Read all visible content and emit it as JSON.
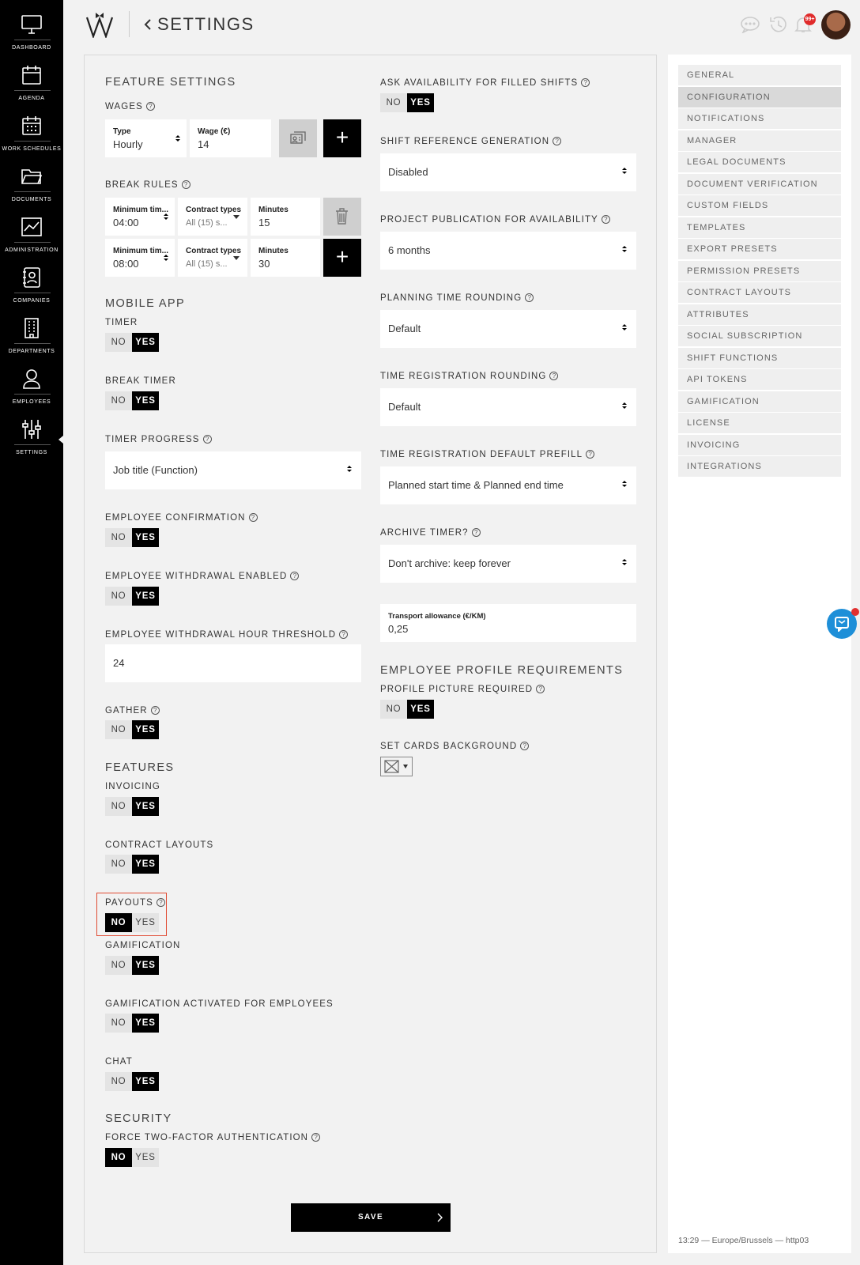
{
  "nav": {
    "items": [
      {
        "label": "DASHBOARD",
        "icon": "monitor-icon"
      },
      {
        "label": "AGENDA",
        "icon": "calendar-icon"
      },
      {
        "label": "WORK SCHEDULES",
        "icon": "calendar-grid-icon"
      },
      {
        "label": "DOCUMENTS",
        "icon": "folder-icon"
      },
      {
        "label": "ADMINISTRATION",
        "icon": "chart-icon"
      },
      {
        "label": "COMPANIES",
        "icon": "contact-book-icon"
      },
      {
        "label": "DEPARTMENTS",
        "icon": "building-icon"
      },
      {
        "label": "EMPLOYEES",
        "icon": "user-icon"
      },
      {
        "label": "SETTINGS",
        "icon": "sliders-icon",
        "selected": true
      }
    ]
  },
  "header": {
    "title": "SETTINGS",
    "notification_count": "99+"
  },
  "feature_settings": {
    "title": "FEATURE SETTINGS",
    "wages": {
      "label": "WAGES",
      "type_label": "Type",
      "type_value": "Hourly",
      "wage_label": "Wage (€)",
      "wage_value": "14"
    },
    "break_rules": {
      "label": "BREAK RULES",
      "rows": [
        {
          "min_label": "Minimum tim...",
          "min_value": "04:00",
          "ct_label": "Contract types",
          "ct_value": "All (15) s...",
          "minutes_label": "Minutes",
          "minutes_value": "15"
        },
        {
          "min_label": "Minimum tim...",
          "min_value": "08:00",
          "ct_label": "Contract types",
          "ct_value": "All (15) s...",
          "minutes_label": "Minutes",
          "minutes_value": "30"
        }
      ]
    }
  },
  "mobile_app": {
    "title": "MOBILE APP",
    "timer": "TIMER",
    "break_timer": "BREAK TIMER",
    "timer_progress": {
      "label": "TIMER PROGRESS",
      "value": "Job title (Function)"
    },
    "employee_confirmation": "EMPLOYEE CONFIRMATION",
    "employee_withdrawal": "EMPLOYEE WITHDRAWAL ENABLED",
    "withdrawal_threshold": {
      "label": "EMPLOYEE WITHDRAWAL HOUR THRESHOLD",
      "value": "24"
    },
    "gather": "GATHER"
  },
  "features": {
    "title": "FEATURES",
    "invoicing": "INVOICING",
    "contract_layouts": "CONTRACT LAYOUTS",
    "payouts": "PAYOUTS",
    "gamification": "GAMIFICATION",
    "gamification_employees": "GAMIFICATION ACTIVATED FOR EMPLOYEES",
    "chat": "CHAT"
  },
  "security": {
    "title": "SECURITY",
    "two_factor": "FORCE TWO-FACTOR AUTHENTICATION"
  },
  "toggle": {
    "no": "NO",
    "yes": "YES"
  },
  "right_column": {
    "ask_availability": "ASK AVAILABILITY FOR FILLED SHIFTS",
    "shift_reference": {
      "label": "SHIFT REFERENCE GENERATION",
      "value": "Disabled"
    },
    "project_publication": {
      "label": "PROJECT PUBLICATION FOR AVAILABILITY",
      "value": "6 months"
    },
    "planning_rounding": {
      "label": "PLANNING TIME ROUNDING",
      "value": "Default"
    },
    "registration_rounding": {
      "label": "TIME REGISTRATION ROUNDING",
      "value": "Default"
    },
    "registration_prefill": {
      "label": "TIME REGISTRATION DEFAULT PREFILL",
      "value": "Planned start time & Planned end time"
    },
    "archive_timer": {
      "label": "ARCHIVE TIMER?",
      "value": "Don't archive: keep forever"
    },
    "transport": {
      "label": "Transport allowance (€/KM)",
      "value": "0,25"
    },
    "profile_requirements_title": "EMPLOYEE PROFILE REQUIREMENTS",
    "profile_picture": "PROFILE PICTURE REQUIRED",
    "cards_background": "SET CARDS BACKGROUND"
  },
  "save_label": "SAVE",
  "side_menu": [
    "GENERAL",
    "CONFIGURATION",
    "NOTIFICATIONS",
    "MANAGER",
    "LEGAL DOCUMENTS",
    "DOCUMENT VERIFICATION",
    "CUSTOM FIELDS",
    "TEMPLATES",
    "EXPORT PRESETS",
    "PERMISSION PRESETS",
    "CONTRACT LAYOUTS",
    "ATTRIBUTES",
    "SOCIAL SUBSCRIPTION",
    "SHIFT FUNCTIONS",
    "API TOKENS",
    "GAMIFICATION",
    "LICENSE",
    "INVOICING",
    "INTEGRATIONS"
  ],
  "status_bar": "13:29 — Europe/Brussels — http03",
  "colors": {
    "accent": "#000000",
    "highlight": "#e04a32",
    "chat": "#1e8fd8",
    "badge": "#e02a2a"
  }
}
